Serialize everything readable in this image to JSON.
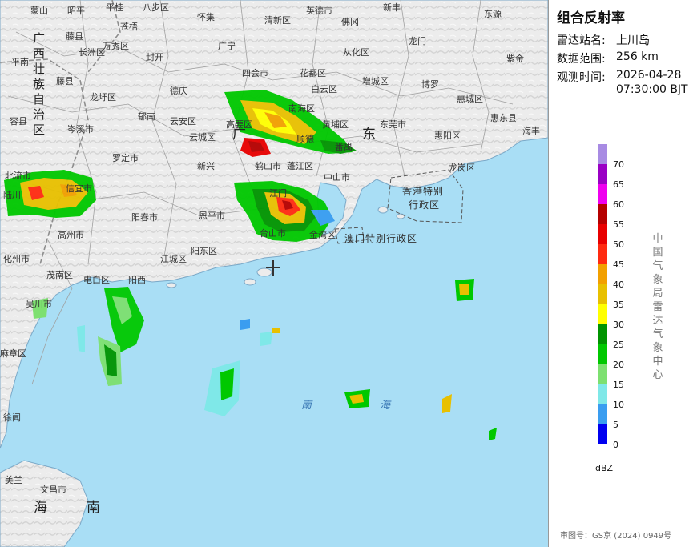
{
  "title": "组合反射率",
  "info": [
    {
      "label": "雷达站名:",
      "value": "上川岛"
    },
    {
      "label": "数据范围:",
      "value": "256 km"
    },
    {
      "label": "观测时间:",
      "value": "2026-04-28"
    }
  ],
  "time2": "07:30:00 BJT",
  "legend": {
    "unit": "dBZ",
    "items": [
      {
        "value": "70",
        "color": "#a88be3"
      },
      {
        "value": "65",
        "color": "#9a00c4"
      },
      {
        "value": "60",
        "color": "#ef00ef"
      },
      {
        "value": "55",
        "color": "#b50000"
      },
      {
        "value": "50",
        "color": "#e80000"
      },
      {
        "value": "45",
        "color": "#ff2a10"
      },
      {
        "value": "40",
        "color": "#f2a000"
      },
      {
        "value": "35",
        "color": "#e8c000"
      },
      {
        "value": "30",
        "color": "#ffff00"
      },
      {
        "value": "25",
        "color": "#009400"
      },
      {
        "value": "20",
        "color": "#00c800"
      },
      {
        "value": "15",
        "color": "#7de070"
      },
      {
        "value": "10",
        "color": "#7fe8e8"
      },
      {
        "value": "5",
        "color": "#3a9df0"
      },
      {
        "value": "0",
        "color": "#0000f0"
      }
    ]
  },
  "agency": "中国气象局雷达气象中心",
  "approval": "审图号：GS京 (2024) 0949号",
  "map_labels": {
    "l1": "蒙山",
    "l2": "昭平",
    "l3": "平桂",
    "l4": "八步区",
    "l5": "怀集",
    "l6": "英德市",
    "l7": "新丰",
    "l8": "东源",
    "l9": "藤县",
    "l10": "万秀区",
    "l11": "苍梧",
    "l12": "长洲区",
    "l13": "封开",
    "l14": "广宁",
    "l15": "清新区",
    "l16": "佛冈",
    "l17": "从化区",
    "l18": "龙门",
    "l19": "紫金",
    "l20": "平南",
    "l21": "藤县",
    "l22": "龙圩区",
    "l23": "郁南",
    "l24": "德庆",
    "l25": "四会市",
    "l26": "花都区",
    "l27": "增城区",
    "l28": "博罗",
    "l29": "惠城区",
    "l30": "容县",
    "l31": "岑溪市",
    "l32": "罗定市",
    "l33": "云安区",
    "l34": "云城区",
    "l35": "高要区",
    "l36": "南海区",
    "l37": "白云区",
    "l38": "黄埔区",
    "l39": "东莞市",
    "l40": "惠阳区",
    "l41": "惠东县",
    "l42": "海丰",
    "l43": "北流市",
    "l44": "信宜市",
    "l45": "新兴",
    "l46": "鹤山市",
    "l47": "蓬江区",
    "l48": "中山市",
    "l49": "龙岗区",
    "l50": "高州市",
    "l51": "阳春市",
    "l52": "恩平市",
    "l53": "台山市",
    "l54": "江门",
    "l55": "化州市",
    "l56": "茂南区",
    "l57": "电白区",
    "l58": "阳西",
    "l59": "江城区",
    "l60": "阳东区",
    "l61": "吴川市",
    "l62": "麻章区",
    "l63": "徐闻",
    "l64": "文昌市",
    "l65": "美兰",
    "l66": "顺德",
    "l67": "番禺",
    "l68": "金湾区",
    "l69": "陆川"
  },
  "region_labels": {
    "guangdong1": "广",
    "guangdong2": "东",
    "guangxi": "广西壮族自治区",
    "hainan1": "海",
    "hainan2": "南"
  },
  "sea_labels": {
    "nan": "南",
    "hai": "海"
  },
  "sar": {
    "hk1": "香港特别",
    "hk2": "行政区",
    "macau": "澳门特别行政区"
  }
}
